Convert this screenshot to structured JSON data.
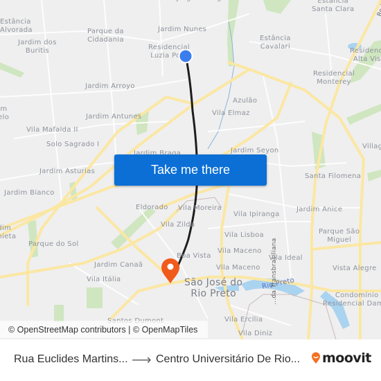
{
  "map": {
    "labels": [
      {
        "text": "Jardim Nunes"
      },
      {
        "text": "Estância\nSanta Clara"
      },
      {
        "text": "Estância\nAlvorada"
      },
      {
        "text": "Parque da\nCidadania"
      },
      {
        "text": "Jardim dos\nBuritis"
      },
      {
        "text": "Residencial\nLuzia Po..."
      },
      {
        "text": "Estância\nCavalari"
      },
      {
        "text": "Residencial\nAlta Vis..."
      },
      {
        "text": "Residencial\nMonterey"
      },
      {
        "text": "Jardim Arroyo"
      },
      {
        "text": "Azulão"
      },
      {
        "text": "Vila Elmaz"
      },
      {
        "text": "Jardim Antunes"
      },
      {
        "text": "...m\nBelo"
      },
      {
        "text": "Vila Mafalda II"
      },
      {
        "text": "Solo Sagrado I"
      },
      {
        "text": "Jardim Braga"
      },
      {
        "text": "Jardim Seyon"
      },
      {
        "text": "Villag..."
      },
      {
        "text": "Jardim Asturias"
      },
      {
        "text": "Santa Filomena"
      },
      {
        "text": "Jardim Bianco"
      },
      {
        "text": "Eldorado"
      },
      {
        "text": "Vila Moreira"
      },
      {
        "text": "Vila Ipiranga"
      },
      {
        "text": "Jardim Anice"
      },
      {
        "text": "...dim\n...hieta"
      },
      {
        "text": "Vila Zilda"
      },
      {
        "text": "Vila Lisboa"
      },
      {
        "text": "Parque São\nMiguel"
      },
      {
        "text": "Parque do Sol"
      },
      {
        "text": "Vila Maceno"
      },
      {
        "text": "Boa Vista"
      },
      {
        "text": "Vila Ideal"
      },
      {
        "text": "Jardim Canaã"
      },
      {
        "text": "Vila Maceno"
      },
      {
        "text": "Vista Alegre"
      },
      {
        "text": "Vila Itália"
      },
      {
        "text": "São José do\nRio Preto"
      },
      {
        "text": "Rio Preto"
      },
      {
        "text": "Condomínio\nResidencial Dam..."
      },
      {
        "text": "Vila Ercília"
      },
      {
        "text": "Vila Diniz"
      },
      {
        "text": "Santos Dumont"
      },
      {
        "text": "...da Transbrasiliana"
      },
      {
        "text": "Rodo..."
      },
      {
        "text": "Jorge Rodrigues"
      }
    ],
    "origin_marker": {
      "color": "#3b7ded"
    },
    "destination_marker": {
      "color": "#f05a1a"
    },
    "route_color": "#1e1e1e"
  },
  "cta": {
    "label": "Take me there"
  },
  "attribution": {
    "text": "© OpenStreetMap contributors | © OpenMapTiles"
  },
  "footer": {
    "from": "Rua Euclides Martins...",
    "arrow": "⟶",
    "to": "Centro Universitário De Rio...",
    "brand": "moovit",
    "brand_color": "#f36f21"
  }
}
